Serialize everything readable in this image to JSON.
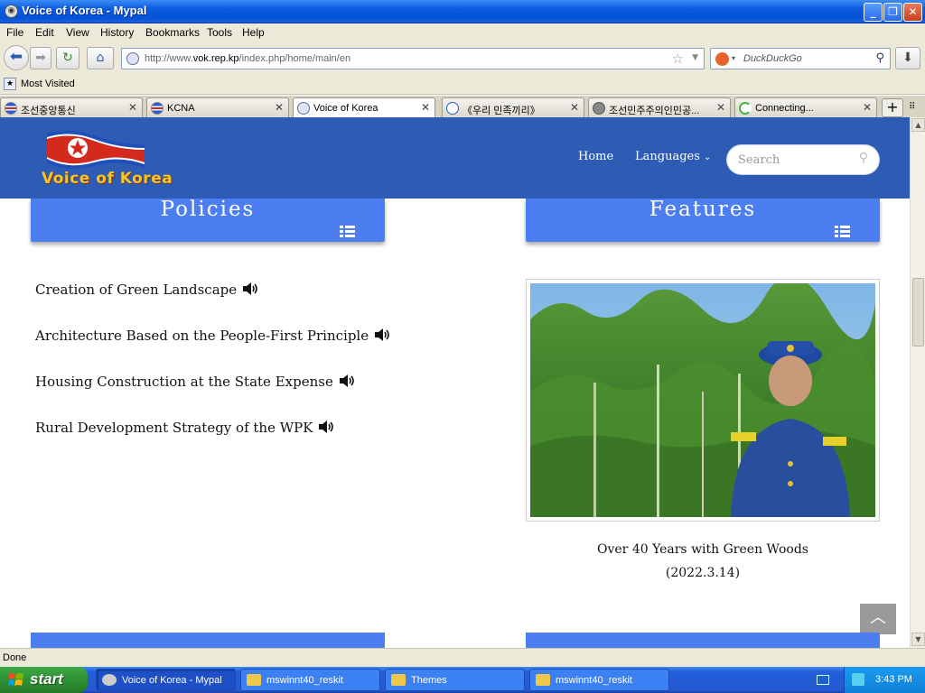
{
  "window": {
    "title": "Voice of Korea - Mypal"
  },
  "menu": [
    "File",
    "Edit",
    "View",
    "History",
    "Bookmarks",
    "Tools",
    "Help"
  ],
  "navbar": {
    "url_prefix": "http://www.",
    "url_domain": "vok.rep.kp",
    "url_path": "/index.php/home/main/en",
    "search_placeholder": "DuckDuckGo"
  },
  "bookmarks": {
    "most_visited": "Most Visited"
  },
  "tabs": [
    {
      "label": "조선중앙통신",
      "active": false
    },
    {
      "label": "KCNA",
      "active": false
    },
    {
      "label": "Voice of Korea",
      "active": true
    },
    {
      "label": "《우리 민족끼리》",
      "active": false
    },
    {
      "label": "조선민주주의인민공...",
      "active": false
    },
    {
      "label": "Connecting...",
      "active": false
    }
  ],
  "site": {
    "logo_text": "Voice of Korea",
    "nav": {
      "home": "Home",
      "languages": "Languages"
    },
    "search_placeholder": "Search",
    "sections": {
      "left": "Policies",
      "right": "Features"
    },
    "articles": [
      "Creation of Green Landscape",
      "Architecture Based on the People-First Principle",
      "Housing Construction at the State Expense",
      "Rural Development Strategy of the WPK"
    ],
    "feature": {
      "caption": "Over 40 Years with Green Woods",
      "date": "(2022.3.14)"
    },
    "colors": {
      "header": "#2e5cb5",
      "section": "#4d7ef1"
    }
  },
  "status": {
    "text": "Done"
  },
  "taskbar": {
    "start": "start",
    "items": [
      {
        "label": "Voice of Korea - Mypal",
        "active": true
      },
      {
        "label": "mswinnt40_reskit",
        "active": false
      },
      {
        "label": "Themes",
        "active": false
      },
      {
        "label": "mswinnt40_reskit",
        "active": false
      }
    ],
    "clock": "3:43 PM"
  }
}
